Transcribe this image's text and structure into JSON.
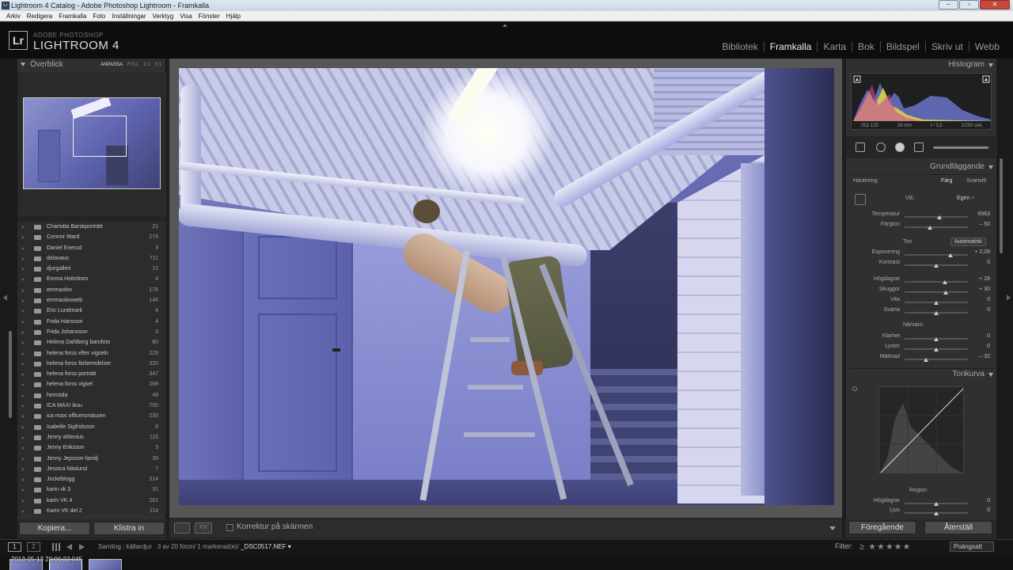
{
  "window": {
    "title": "Lightroom 4 Catalog - Adobe Photoshop Lightroom - Framkalla",
    "buttons": [
      "–",
      "▫",
      "✕"
    ]
  },
  "menubar": [
    "Arkiv",
    "Redigera",
    "Framkalla",
    "Foto",
    "Inställningar",
    "Verktyg",
    "Visa",
    "Fönster",
    "Hjälp"
  ],
  "brand": {
    "logo": "Lr",
    "line1": "ADOBE PHOTOSHOP",
    "line2": "LIGHTROOM 4"
  },
  "modules": [
    {
      "label": "Bibliotek",
      "active": false
    },
    {
      "label": "Framkalla",
      "active": true
    },
    {
      "label": "Karta",
      "active": false
    },
    {
      "label": "Bok",
      "active": false
    },
    {
      "label": "Bildspel",
      "active": false
    },
    {
      "label": "Skriv ut",
      "active": false
    },
    {
      "label": "Webb",
      "active": false
    }
  ],
  "navigator": {
    "title": "Överblick",
    "options": [
      "ANPASSA",
      "FYLL",
      "1:1",
      "3:1"
    ]
  },
  "collections": [
    {
      "name": "Charlotta Barskporträtt",
      "count": "21"
    },
    {
      "name": "Connor Ward",
      "count": "274"
    },
    {
      "name": "Daniel Enerud",
      "count": "3"
    },
    {
      "name": "delavaux",
      "count": "711"
    },
    {
      "name": "djurgalleri",
      "count": "12"
    },
    {
      "name": "Emma Holmbom",
      "count": "4"
    },
    {
      "name": "emmaolov",
      "count": "176"
    },
    {
      "name": "emmaolovweb",
      "count": "146"
    },
    {
      "name": "Eric Lundmark",
      "count": "4"
    },
    {
      "name": "Frida Hansson",
      "count": "4"
    },
    {
      "name": "Frida Johansson",
      "count": "3"
    },
    {
      "name": "Helena Dahlberg barnfoto",
      "count": "80"
    },
    {
      "name": "helena forss efter vigseln",
      "count": "226"
    },
    {
      "name": "helena forss förberedelser",
      "count": "320"
    },
    {
      "name": "helena forss porträtt",
      "count": "347"
    },
    {
      "name": "helena forss vigsel",
      "count": "288"
    },
    {
      "name": "hemsida",
      "count": "48"
    },
    {
      "name": "ICA MAXI iksu",
      "count": "700"
    },
    {
      "name": "ica maxi officersmässen",
      "count": "235"
    },
    {
      "name": "Isabelle Sigfridsson",
      "count": "8"
    },
    {
      "name": "Jenny ahlenius",
      "count": "115"
    },
    {
      "name": "Jenny Eriksson",
      "count": "3"
    },
    {
      "name": "Jenny Jepsson familj",
      "count": "39"
    },
    {
      "name": "Jessica Näslund",
      "count": "7"
    },
    {
      "name": "Jockeblogg",
      "count": "314"
    },
    {
      "name": "karin vk 3",
      "count": "31"
    },
    {
      "name": "karin VK 4",
      "count": "261"
    },
    {
      "name": "Karin VK del 2",
      "count": "114"
    }
  ],
  "left_buttons": {
    "copy": "Kopiera...",
    "paste": "Klistra in"
  },
  "toolbar": {
    "proof_label": "Korrektur på skärmen",
    "yy": "Y|Y"
  },
  "histogram": {
    "title": "Histogram",
    "info": [
      "ISO 125",
      "28 mm",
      "f / 3,5",
      "1/200 sek."
    ]
  },
  "basic": {
    "title": "Grundläggande",
    "treatment_label": "Hantering:",
    "treatment_color": "Färg",
    "treatment_bw": "Svartvitt",
    "wb_label": "VB:",
    "wb_value": "Egen ÷",
    "tone_label": "Ton",
    "auto_label": "Automatisk",
    "presence_label": "Närvaro",
    "sliders": [
      {
        "label": "Temperatur",
        "value": "6563",
        "level": 0.55,
        "group": "wb"
      },
      {
        "label": "Färgton",
        "value": "– 50",
        "level": 0.4,
        "group": "wb"
      },
      {
        "label": "Exponering",
        "value": "+ 2,09",
        "level": 0.72,
        "group": "tone"
      },
      {
        "label": "Kontrast",
        "value": "0",
        "level": 0.5,
        "group": "tone"
      },
      {
        "label": "Högdagrar",
        "value": "+ 28",
        "level": 0.64,
        "group": "tone2"
      },
      {
        "label": "Skuggor",
        "value": "+ 30",
        "level": 0.65,
        "group": "tone2"
      },
      {
        "label": "Vita",
        "value": "0",
        "level": 0.5,
        "group": "tone2"
      },
      {
        "label": "Svärta",
        "value": "0",
        "level": 0.5,
        "group": "tone2"
      },
      {
        "label": "Klarhet",
        "value": "0",
        "level": 0.5,
        "group": "presence"
      },
      {
        "label": "Lyster",
        "value": "0",
        "level": 0.5,
        "group": "presence"
      },
      {
        "label": "Mättnad",
        "value": "– 32",
        "level": 0.34,
        "group": "presence"
      }
    ]
  },
  "tonecurve": {
    "title": "Tonkurva",
    "region_label": "Region",
    "sliders": [
      {
        "label": "Högdagrar",
        "value": "0",
        "level": 0.5
      },
      {
        "label": "Ljus",
        "value": "0",
        "level": 0.5
      }
    ]
  },
  "right_buttons": {
    "prev": "Föregående",
    "reset": "Återställ"
  },
  "status": {
    "btn1": "1",
    "btn2": "2",
    "source": "Samling : källardjur",
    "count": "3 av 20 foton/ 1 markerad(e)/",
    "file": "_DSC0517.NEF ▾",
    "filter_label": "Filter:",
    "stars": "≥ ★★★★★",
    "sort": "Poängsatt",
    "date": "2013-05-13 20:06:22.045"
  },
  "colors": {
    "accent": "#eeeeee",
    "panel": "#303030",
    "background": "#565656"
  }
}
